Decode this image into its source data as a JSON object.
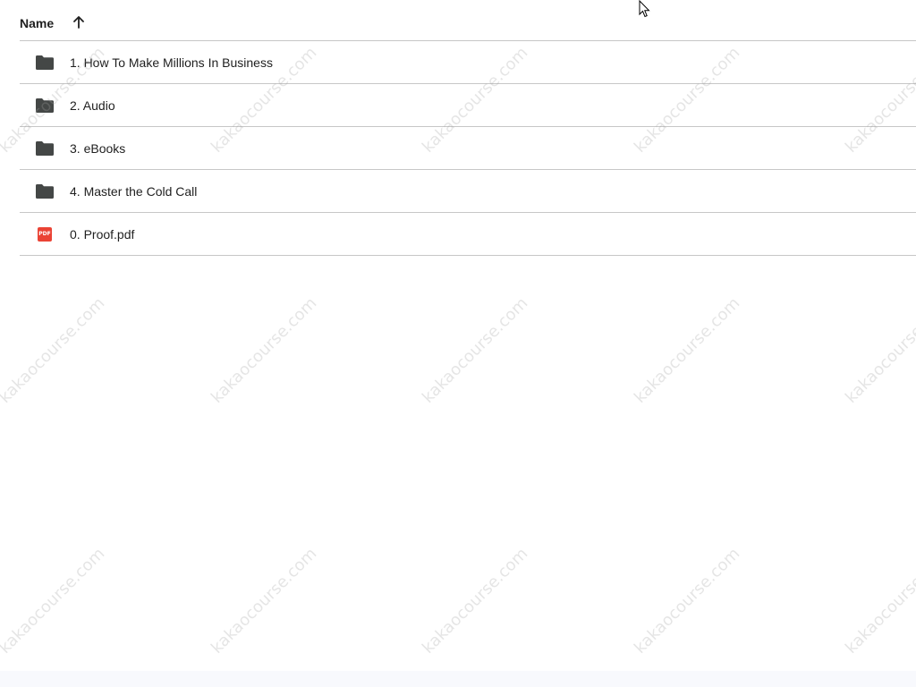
{
  "header": {
    "name_label": "Name",
    "sort_icon": "arrow-up-icon"
  },
  "files": [
    {
      "label": "1. How To Make Millions In Business",
      "icon": "folder-icon"
    },
    {
      "label": "2. Audio",
      "icon": "folder-icon"
    },
    {
      "label": "3. eBooks",
      "icon": "folder-icon"
    },
    {
      "label": "4. Master the Cold Call",
      "icon": "folder-icon"
    },
    {
      "label": "0. Proof.pdf",
      "icon": "pdf-icon",
      "badge": "PDF"
    }
  ],
  "watermark": {
    "text": "kakaocourse.com"
  },
  "colors": {
    "folder": "#444746",
    "pdf": "#ea4335",
    "divider": "#c7c7c7"
  }
}
